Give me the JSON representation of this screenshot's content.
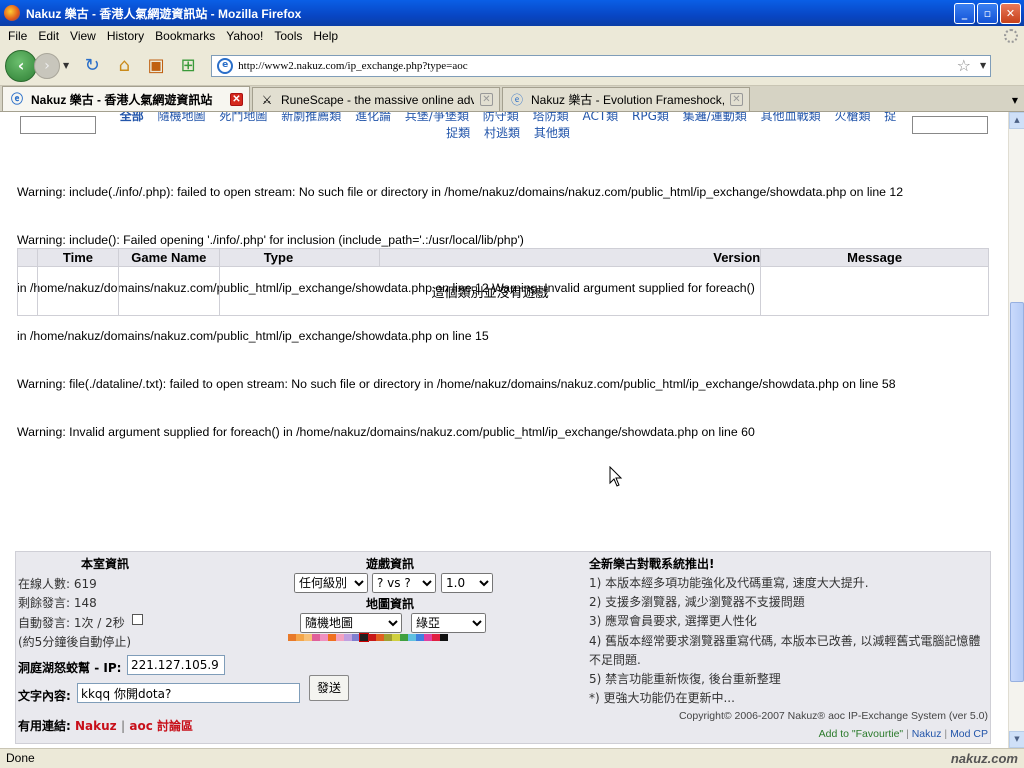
{
  "window": {
    "title": "Nakuz 樂古 - 香港人氣網遊資訊站 - Mozilla Firefox",
    "btn_min": "_",
    "btn_max": "▫",
    "btn_close": "✕"
  },
  "menu": [
    "File",
    "Edit",
    "View",
    "History",
    "Bookmarks",
    "Yahoo!",
    "Tools",
    "Help"
  ],
  "nav": {
    "url": "http://www2.nakuz.com/ip_exchange.php?type=aoc"
  },
  "tabs": [
    {
      "label": "Nakuz 樂古 - 香港人氣網遊資訊站",
      "active": true
    },
    {
      "label": "RuneScape - the massive online advent···",
      "active": false
    },
    {
      "label": "Nakuz 樂古 - Evolution Frameshock, ···",
      "active": false
    }
  ],
  "categories": {
    "row1": [
      "全部",
      "隨機地圖",
      "死鬥地圖",
      "新劇推薦類",
      "進化論",
      "兵堡/爭堡類",
      "防守類",
      "塔防類",
      "ACT類",
      "RPG類",
      "集邏/運動類",
      "其他血戰類",
      "火槍類",
      "捉"
    ],
    "row2": [
      "捉類",
      "村逃類",
      "其他類"
    ]
  },
  "warnings": [
    "Warning: include(./info/.php): failed to open stream: No such file or directory in /home/nakuz/domains/nakuz.com/public_html/ip_exchange/showdata.php on line 12",
    "Warning: include(): Failed opening './info/.php' for inclusion (include_path='.:/usr/local/lib/php')",
    "in /home/nakuz/domains/nakuz.com/public_html/ip_exchange/showdata.php on line 12 Warning: Invalid argument supplied for foreach()",
    "in /home/nakuz/domains/nakuz.com/public_html/ip_exchange/showdata.php on line 15",
    "Warning: file(./dataline/.txt): failed to open stream: No such file or directory in /home/nakuz/domains/nakuz.com/public_html/ip_exchange/showdata.php on line 58",
    "Warning: Invalid argument supplied for foreach() in /home/nakuz/domains/nakuz.com/public_html/ip_exchange/showdata.php on line 60"
  ],
  "table": {
    "headers": [
      "",
      "Time",
      "Game Name",
      "Type",
      "Version",
      "Message"
    ],
    "empty_message": "這個類別並沒有遊戲"
  },
  "room": {
    "heading": "本室資訊",
    "online": "在線人數: 619",
    "remaining": "剩餘發言: 148",
    "auto_label": "自動發言: 1次 / 2秒",
    "auto_note": "(約5分鐘後自動停止)"
  },
  "game": {
    "heading": "遊戲資訊",
    "level": "任何級別",
    "vs": "? vs ?",
    "version": "1.0",
    "map_heading": "地圖資訊",
    "map": "隨機地圖",
    "region": "綠亞"
  },
  "palette": [
    "#e87a2a",
    "#f4a64a",
    "#f7c078",
    "#e0609a",
    "#f090c0",
    "#f07020",
    "#f3a2c0",
    "#c0a0e0",
    "#8080d0",
    "#202020",
    "#c81818",
    "#e06020",
    "#a0a030",
    "#d0d040",
    "#40a040",
    "#60c0e0",
    "#4080e0",
    "#e040a0",
    "#e02040",
    "#101010"
  ],
  "form": {
    "ip_label": "洞庭湖怒蛟幫",
    "ip_suffix": "- IP:",
    "ip_value": "221.127.105.9",
    "text_label": "文字內容:",
    "text_value": "kkqq 你開dota?",
    "send": "發送"
  },
  "links": {
    "label": "有用連結:",
    "nakuz": "Nakuz",
    "sep": "|",
    "aoc": "aoc 討論區"
  },
  "news": {
    "heading": "全新樂古對戰系統推出!",
    "items": [
      "1) 本版本經多項功能強化及代碼重寫, 速度大大提升.",
      "2) 支援多瀏覽器, 減少瀏覽器不支援問題",
      "3) 應眾會員要求, 選擇更人性化",
      "4) 舊版本經常要求瀏覽器重寫代碼, 本版本已改善, 以減輕舊式電腦記憶體",
      "不足問題.",
      "5) 禁言功能重新恢復, 後台重新整理",
      "*) 更強大功能仍在更新中..."
    ],
    "copyright": "Copyright© 2006-2007  Nakuz® aoc IP-Exchange System (ver 5.0)",
    "fav": "Add to \"Favourtie\"",
    "nakuz": "Nakuz",
    "modcp": "Mod CP"
  },
  "status": {
    "text": "Done",
    "brand": "nakuz.com"
  }
}
